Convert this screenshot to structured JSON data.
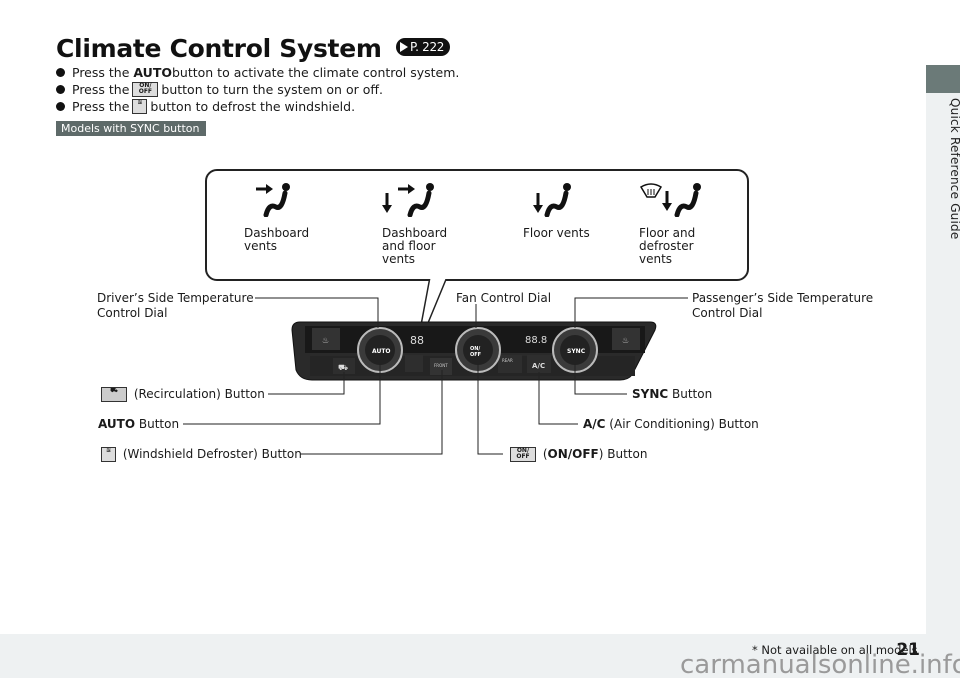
{
  "page": {
    "title": "Climate Control System",
    "page_ref": "P. 222",
    "section_tab": "Quick Reference Guide",
    "page_number": "21",
    "footnote": "* Not available on all models",
    "watermark": "carmanualsonline.info"
  },
  "bullets": [
    {
      "prefix": "Press the ",
      "bold": "AUTO",
      "icon": null,
      "suffix": " button to activate the climate control system."
    },
    {
      "prefix": "Press the ",
      "bold": "",
      "icon": "on-off-icon",
      "suffix": " button to turn the system on or off."
    },
    {
      "prefix": "Press the ",
      "bold": "",
      "icon": "front-defrost-icon",
      "suffix": " button to defrost the windshield."
    }
  ],
  "model_badge": "Models with SYNC button",
  "vent_modes": [
    {
      "icon": "dashboard-vent-mode-icon",
      "label_lines": [
        "Dashboard",
        "vents"
      ]
    },
    {
      "icon": "dashboard-floor-vent-mode-icon",
      "label_lines": [
        "Dashboard",
        "and floor",
        "vents"
      ]
    },
    {
      "icon": "floor-vent-mode-icon",
      "label_lines": [
        "Floor vents"
      ]
    },
    {
      "icon": "floor-defroster-vent-mode-icon",
      "label_lines": [
        "Floor and",
        "defroster",
        "vents"
      ]
    }
  ],
  "callouts": {
    "driver_temp": [
      "Driver’s Side Temperature",
      "Control Dial"
    ],
    "fan": "Fan Control Dial",
    "passenger_temp": [
      "Passenger’s Side Temperature",
      "Control Dial"
    ],
    "recirc": {
      "icon": "recirculation-icon",
      "text": " (Recirculation) Button"
    },
    "auto": {
      "bold": "AUTO",
      "text": " Button"
    },
    "defrost": {
      "icon": "front-defrost-icon",
      "text": " (Windshield Defroster) Button"
    },
    "sync": {
      "bold": "SYNC",
      "text": " Button"
    },
    "ac": {
      "bold": "A/C",
      "text": " (Air Conditioning) Button"
    },
    "onoff": {
      "icon": "on-off-icon",
      "pre": " (",
      "bold": "ON/OFF",
      "text": ") Button"
    }
  },
  "panel": {
    "dial_left": "AUTO",
    "dial_center": "ON/OFF",
    "dial_right": "SYNC",
    "display_left": "88",
    "display_right": "88.8",
    "ac_label": "A/C",
    "rear_label": "REAR",
    "front_label": "FRONT",
    "on_label": "ON/",
    "off_label": "OFF"
  }
}
